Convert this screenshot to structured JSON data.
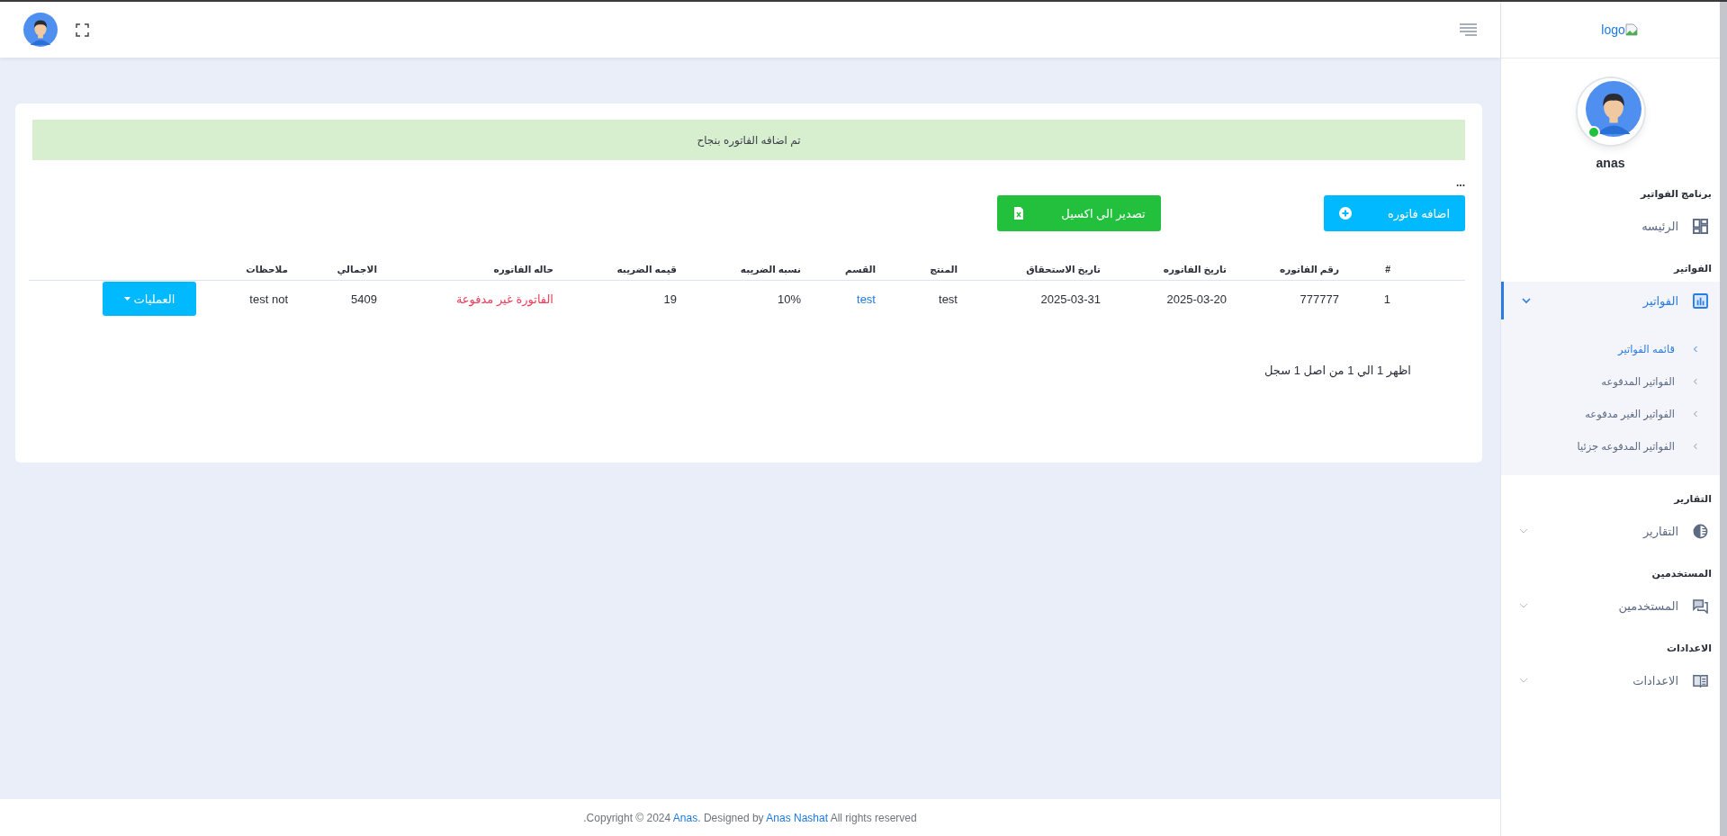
{
  "sidebar": {
    "logo": "logo",
    "user": {
      "name": "anas",
      "online": true
    },
    "sections": [
      {
        "heading": "برنامج الفواتير",
        "items": [
          {
            "label": "الرئيسه",
            "selected": false
          }
        ]
      },
      {
        "heading": "الفواتير",
        "items": [
          {
            "label": "الفواتير",
            "selected": true,
            "expanded": true,
            "children": [
              {
                "label": "قائمه الفواتير",
                "selected": true
              },
              {
                "label": "الفواتير المدفوعه",
                "selected": false
              },
              {
                "label": "الفواتير الغير مدفوعه",
                "selected": false
              },
              {
                "label": "الفواتير المدفوعه جزئيا",
                "selected": false
              }
            ]
          }
        ]
      },
      {
        "heading": "التقارير",
        "items": [
          {
            "label": "التقارير",
            "selected": false,
            "expanded": false
          }
        ]
      },
      {
        "heading": "المستخدمين",
        "items": [
          {
            "label": "المستخدمين",
            "selected": false,
            "expanded": false
          }
        ]
      },
      {
        "heading": "الاعدادات",
        "items": [
          {
            "label": "الاعدادات",
            "selected": false,
            "expanded": false
          }
        ]
      }
    ]
  },
  "alert": "تم اضافه الفاتوره بنجاح",
  "more": "...",
  "buttons": [
    {
      "label": "اضافه فاتوره",
      "kind": "add"
    },
    {
      "label": "تصدير الي اكسيل",
      "kind": "excel"
    }
  ],
  "table": {
    "columns": [
      "#",
      "رقم الفاتوره",
      "تاريخ الفاتوره",
      "تاريخ الاستحقاق",
      "المنتج",
      "القسم",
      "نسبه الضريبه",
      "قيمه الضريبه",
      "حاله الفاتوره",
      "الاجمالي",
      "ملاحظات"
    ],
    "rows": [
      {
        "cells": [
          {
            "text": "1",
            "kind": "text"
          },
          {
            "text": "777777",
            "kind": "text"
          },
          {
            "text": "2025-03-20",
            "kind": "text"
          },
          {
            "text": "2025-03-31",
            "kind": "text"
          },
          {
            "text": "test",
            "kind": "text"
          },
          {
            "text": "test",
            "kind": "link"
          },
          {
            "text": "10%",
            "kind": "text"
          },
          {
            "text": "19",
            "kind": "text"
          },
          {
            "text": "الفاتورة غير مدفوعة",
            "kind": "status"
          },
          {
            "text": "5409",
            "kind": "text"
          },
          {
            "text": "test not",
            "kind": "text"
          },
          {
            "text": "العمليات",
            "kind": "dropdown"
          }
        ]
      }
    ]
  },
  "pagination": "اظهر 1 الي 1 من اصل 1 سجل",
  "footer": {
    "copyright": ".Copyright © 2024 ",
    "author_link": "Anas",
    "designed_by": ". Designed by ",
    "designer_link": "Anas Nashat",
    "rights": " All rights reserved"
  }
}
